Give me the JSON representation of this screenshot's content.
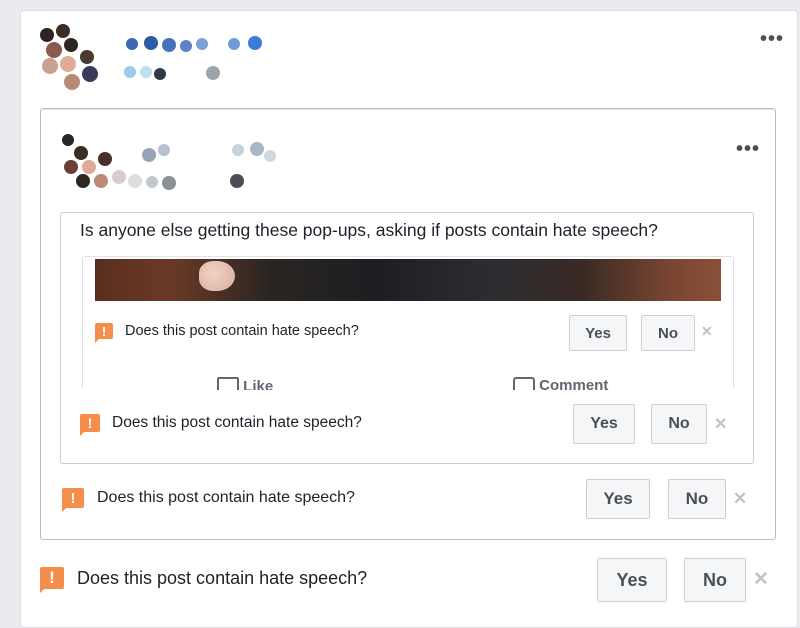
{
  "more_options": "•••",
  "post": {
    "text": "Is anyone else getting these pop-ups, asking if posts contain hate speech?"
  },
  "prompt": {
    "question": "Does this post contain hate speech?",
    "yes_label": "Yes",
    "no_label": "No",
    "close_glyph": "✕",
    "alert_glyph": "!"
  },
  "actions": {
    "like_label": "Like",
    "comment_label": "Comment"
  },
  "colors": {
    "alert": "#f58d4d",
    "button_bg": "#f5f6f7",
    "border": "#ccd0d5"
  }
}
